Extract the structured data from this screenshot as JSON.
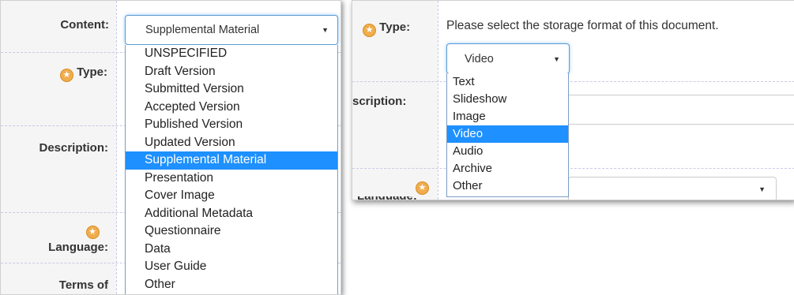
{
  "left_form": {
    "labels": {
      "content": "Content:",
      "type": "Type:",
      "description": "Description:",
      "language": "Language:",
      "terms_of": "Terms of"
    },
    "content_select": {
      "value": "Supplemental Material",
      "options": [
        "UNSPECIFIED",
        "Draft Version",
        "Submitted Version",
        "Accepted Version",
        "Published Version",
        "Updated Version",
        "Supplemental Material",
        "Presentation",
        "Cover Image",
        "Additional Metadata",
        "Questionnaire",
        "Data",
        "User Guide",
        "Other"
      ],
      "selected_index": 6
    }
  },
  "right_form": {
    "labels": {
      "type": "Type:",
      "description_partial": "scription:"
    },
    "instruction": "Please select the storage format of this document.",
    "format_select": {
      "value": "Video",
      "options": [
        "Text",
        "Slideshow",
        "Image",
        "Video",
        "Audio",
        "Archive",
        "Other"
      ],
      "selected_index": 3
    }
  },
  "colors": {
    "highlight": "#1e90ff",
    "label_background": "#f5f5f5",
    "star_icon": "#f0ad4e",
    "focus_border": "#5b9bd5"
  }
}
